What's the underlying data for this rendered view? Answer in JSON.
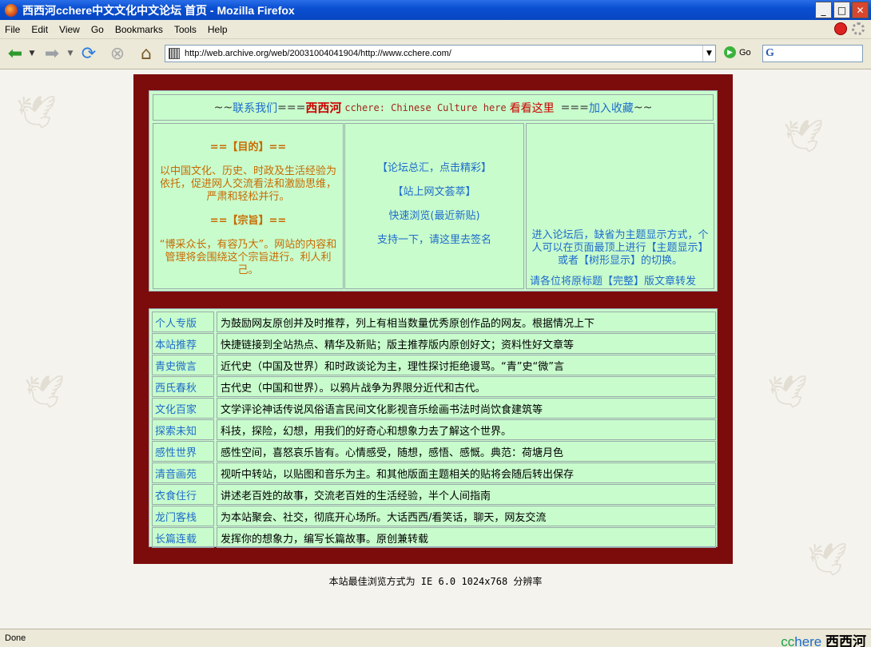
{
  "window": {
    "title": "西西河cchere中文文化中文论坛 首页 - Mozilla Firefox",
    "min": "_",
    "max": "□",
    "close": "✕"
  },
  "menu": [
    "File",
    "Edit",
    "View",
    "Go",
    "Bookmarks",
    "Tools",
    "Help"
  ],
  "nav": {
    "url": "http://web.archive.org/web/20031004041904/http://www.cchere.com/",
    "go_label": "Go",
    "search_engine": "G"
  },
  "header": {
    "tilde_left": "~~",
    "contact": "联系我们",
    "eq1": "===",
    "brand": "西西河",
    "english": "cchere: Chinese Culture here",
    "look": "看看这里",
    "eq2": "===",
    "bookmark": "加入收藏",
    "tilde_right": "~~"
  },
  "col1": {
    "purpose_title": "==【目的】==",
    "purpose_text": "以中国文化、历史、时政及生活经验为依托，促进网人交流看法和激励思维，严肃和轻松并行。",
    "tenet_title": "==【宗旨】==",
    "tenet_text": "“博采众长，有容乃大”。网站的内容和管理将会围绕这个宗旨进行。利人利己。"
  },
  "col2": {
    "links": [
      "【论坛总汇，点击精彩】",
      "【站上网文荟萃】",
      "快速浏览(最近新贴)",
      "支持一下，请这里去签名"
    ]
  },
  "col3": {
    "text1": "进入论坛后，缺省为主题显示方式，个人可以在页面最顶上进行【主题显示】或者【树形显示】的切换。",
    "text2": "请各位将原标题【完整】版文章转发"
  },
  "forums": [
    {
      "name": "个人专版",
      "desc": "为鼓励网友原创并及时推荐，列上有相当数量优秀原创作品的网友。根据情况上下"
    },
    {
      "name": "本站推荐",
      "desc": "快捷链接到全站热点、精华及新贴；版主推荐版内原创好文；资料性好文章等"
    },
    {
      "name": "青史微言",
      "desc": "近代史（中国及世界）和时政谈论为主，理性探讨拒绝谩骂。“青”史“微”言"
    },
    {
      "name": "西氏春秋",
      "desc": "古代史（中国和世界）。以鸦片战争为界限分近代和古代。"
    },
    {
      "name": "文化百家",
      "desc": "文学评论神话传说风俗语言民间文化影视音乐绘画书法时尚饮食建筑等"
    },
    {
      "name": "探索未知",
      "desc": "科技，探险，幻想，用我们的好奇心和想象力去了解这个世界。"
    },
    {
      "name": "感性世界",
      "desc": "感性空间，喜怒哀乐皆有。心情感受，随想，感悟、感慨。典范：荷塘月色"
    },
    {
      "name": "清音画苑",
      "desc": "视听中转站，以贴图和音乐为主。和其他版面主题相关的贴将会随后转出保存"
    },
    {
      "name": "衣食住行",
      "desc": "讲述老百姓的故事，交流老百姓的生活经验，半个人间指南"
    },
    {
      "name": "龙门客栈",
      "desc": "为本站聚会、社交，彻底开心场所。大话西西/看笑话，聊天，网友交流"
    },
    {
      "name": "长篇连载",
      "desc": "发挥你的想象力，编写长篇故事。原创兼转载"
    }
  ],
  "footer": "本站最佳浏览方式为 IE 6.0 1024x768 分辨率",
  "status": {
    "text": "Done",
    "logo_cc": "cc",
    "logo_here": "here",
    "logo_cn": "西西河"
  }
}
